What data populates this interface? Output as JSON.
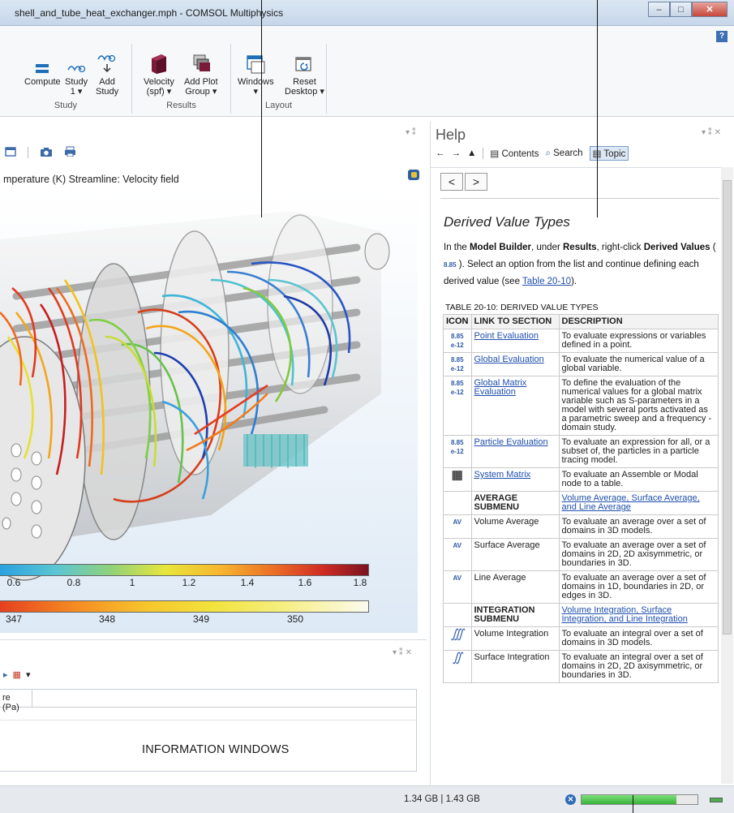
{
  "window": {
    "title": "shell_and_tube_heat_exchanger.mph - COMSOL Multiphysics",
    "help_question": "?"
  },
  "ribbon": {
    "groups": [
      {
        "label": "Study",
        "buttons": [
          {
            "label": "Compute"
          },
          {
            "label": "Study\n1 ▾"
          },
          {
            "label": "Add\nStudy"
          }
        ]
      },
      {
        "label": "Results",
        "buttons": [
          {
            "label": "Velocity\n(spf) ▾"
          },
          {
            "label": "Add Plot\nGroup ▾"
          }
        ]
      },
      {
        "label": "Layout",
        "buttons": [
          {
            "label": "Windows\n▾"
          },
          {
            "label": "Reset\nDesktop ▾"
          }
        ]
      }
    ]
  },
  "graphics": {
    "plot_title": "mperature (K)  Streamline: Velocity field",
    "legend_top": {
      "ticks": [
        "0.6",
        "0.8",
        "1",
        "1.2",
        "1.4",
        "1.6",
        "1.8"
      ]
    },
    "legend_bottom": {
      "ticks": [
        "347",
        "348",
        "349",
        "350"
      ]
    }
  },
  "info": {
    "column_header": "re (Pa)",
    "caption": "INFORMATION WINDOWS"
  },
  "help": {
    "title": "Help",
    "nav": {
      "contents": "Contents",
      "search": "Search",
      "topic": "Topic"
    },
    "back_btn": "<",
    "forward_btn": ">",
    "heading": "Derived Value Types",
    "para": {
      "p1": "In the ",
      "b1": "Model Builder",
      "p2": ", under ",
      "b2": "Results",
      "p3": ", right-click ",
      "b3": "Derived Values",
      "p4": " ( ",
      "p5": " ). Select an option from the list and continue defining each derived value (see ",
      "link": "Table 20-10",
      "p6": ")."
    },
    "table_caption": "TABLE 20-10: DERIVED VALUE TYPES",
    "table_headers": [
      "ICON",
      "LINK TO SECTION",
      "DESCRIPTION"
    ],
    "rows": [
      {
        "icon": "8.85\ne-12",
        "link": "Point Evaluation",
        "desc": "To evaluate expressions or variables defined in a point."
      },
      {
        "icon": "8.85\ne-12",
        "link": "Global Evaluation",
        "desc": "To evaluate the numerical value of a global variable."
      },
      {
        "icon": "8.85\ne-12",
        "link": "Global Matrix Evaluation",
        "desc": "To define the evaluation of the numerical values for a global matrix variable such as S-parameters in a model with several ports activated as a parametric sweep and a frequency -domain study."
      },
      {
        "icon": "8.85\ne-12",
        "link": "Particle Evaluation",
        "desc": "To evaluate an expression for all, or a subset of, the particles in a particle tracing model."
      },
      {
        "icon": "▦",
        "link": "System Matrix",
        "desc": "To evaluate an Assemble or Modal node to a table."
      },
      {
        "icon": "",
        "bold": "AVERAGE SUBMENU",
        "desclink": "Volume Average, Surface Average, and Line Average"
      },
      {
        "icon": "AV",
        "plain": "Volume Average",
        "desc": "To evaluate an average over a set of domains in 3D models."
      },
      {
        "icon": "AV",
        "plain": "Surface Average",
        "desc": "To evaluate an average over a set of domains in 2D, 2D axisymmetric, or boundaries in 3D."
      },
      {
        "icon": "AV",
        "plain": "Line Average",
        "desc": "To evaluate an average over a set of domains in 1D, boundaries in 2D, or edges in 3D."
      },
      {
        "icon": "",
        "bold": "INTEGRATION SUBMENU",
        "desclink": "Volume Integration, Surface Integration, and Line Integration"
      },
      {
        "icon": "∭",
        "plain": "Volume Integration",
        "desc": "To evaluate an integral over a set of domains in 3D models."
      },
      {
        "icon": "∬",
        "plain": "Surface Integration",
        "desc": "To evaluate an integral over a set of domains in 2D, 2D axisymmetric, or boundaries in 3D."
      }
    ]
  },
  "status": {
    "memory": "1.34 GB | 1.43 GB",
    "progress": 0.82
  },
  "colors": {
    "accent": "#2f6db5",
    "link": "#1f4fae",
    "ribbon_icon": "#1e6fb8",
    "results_icon": "#7b1b3a"
  }
}
